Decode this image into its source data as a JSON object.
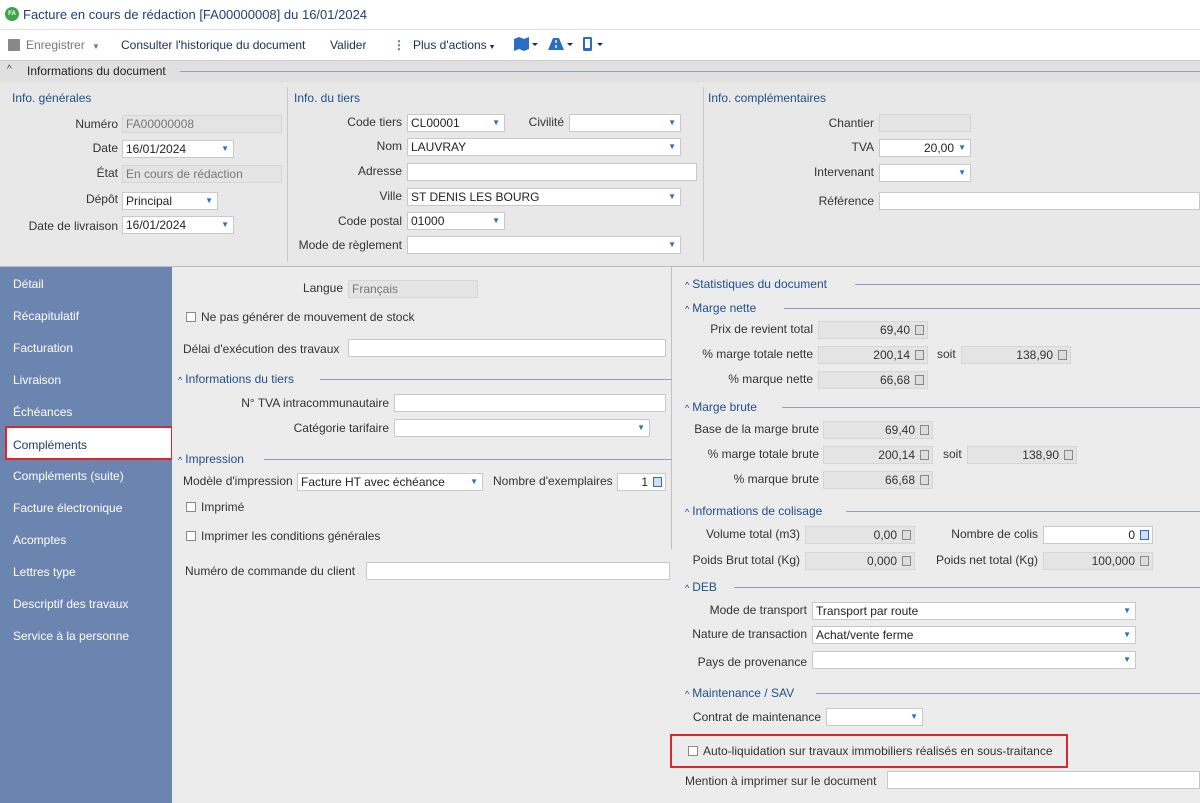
{
  "window": {
    "badge": "FA",
    "title": "Facture en cours de rédaction [FA00000008] du 16/01/2024"
  },
  "toolbar": {
    "save": "Enregistrer",
    "history": "Consulter l'historique du document",
    "validate": "Valider",
    "more": "Plus d'actions"
  },
  "info_header": "Informations du document",
  "general": {
    "title": "Info. générales",
    "numero_label": "Numéro",
    "numero": "FA00000008",
    "date_label": "Date",
    "date": "16/01/2024",
    "etat_label": "État",
    "etat": "En cours de rédaction",
    "depot_label": "Dépôt",
    "depot": "Principal",
    "livraison_label": "Date de livraison",
    "livraison": "16/01/2024"
  },
  "tiers": {
    "title": "Info. du tiers",
    "code_label": "Code tiers",
    "code": "CL00001",
    "civilite_label": "Civilité",
    "civilite": "",
    "nom_label": "Nom",
    "nom": "LAUVRAY",
    "adresse_label": "Adresse",
    "adresse": "",
    "ville_label": "Ville",
    "ville": "ST DENIS LES BOURG",
    "cp_label": "Code postal",
    "cp": "01000",
    "reglement_label": "Mode de règlement",
    "reglement": ""
  },
  "compl": {
    "title": "Info. complémentaires",
    "chantier_label": "Chantier",
    "chantier": "",
    "tva_label": "TVA",
    "tva": "20,00",
    "intervenant_label": "Intervenant",
    "intervenant": "",
    "reference_label": "Référence",
    "reference": ""
  },
  "sidebar": [
    "Détail",
    "Récapitulatif",
    "Facturation",
    "Livraison",
    "Échéances",
    "Compléments",
    "Compléments (suite)",
    "Facture électronique",
    "Acomptes",
    "Lettres type",
    "Descriptif des travaux",
    "Service à la personne"
  ],
  "left": {
    "langue_label": "Langue",
    "langue": "Français",
    "stock_label": "Ne pas générer de mouvement de stock",
    "delai_label": "Délai d'exécution des travaux",
    "delai": "",
    "tiers_group": "Informations du tiers",
    "tva_intra_label": "N° TVA intracommunautaire",
    "tva_intra": "",
    "categorie_label": "Catégorie tarifaire",
    "categorie": "",
    "impression_group": "Impression",
    "modele_label": "Modèle d'impression",
    "modele": "Facture HT avec échéance",
    "exemplaires_label": "Nombre d'exemplaires",
    "exemplaires": "1",
    "imprime_label": "Imprimé",
    "conditions_label": "Imprimer les conditions générales",
    "commande_label": "Numéro de commande du client",
    "commande": ""
  },
  "right": {
    "stats_group": "Statistiques du document",
    "marge_nette_group": "Marge nette",
    "prix_revient_label": "Prix de revient total",
    "prix_revient": "69,40",
    "pct_marge_nette_label": "% marge totale nette",
    "pct_marge_nette": "200,14",
    "soit_label": "soit",
    "soit_nette": "138,90",
    "pct_marque_nette_label": "% marque nette",
    "pct_marque_nette": "66,68",
    "marge_brute_group": "Marge brute",
    "base_marge_label": "Base de la marge brute",
    "base_marge": "69,40",
    "pct_marge_brute_label": "% marge totale brute",
    "pct_marge_brute": "200,14",
    "soit_brute": "138,90",
    "pct_marque_brute_label": "% marque brute",
    "pct_marque_brute": "66,68",
    "colisage_group": "Informations de colisage",
    "volume_label": "Volume total (m3)",
    "volume": "0,00",
    "colis_label": "Nombre de colis",
    "colis": "0",
    "poids_brut_label": "Poids Brut total (Kg)",
    "poids_brut": "0,000",
    "poids_net_label": "Poids net total (Kg)",
    "poids_net": "100,000",
    "deb_group": "DEB",
    "transport_label": "Mode de transport",
    "transport": "Transport par route",
    "transaction_label": "Nature de transaction",
    "transaction": "Achat/vente ferme",
    "provenance_label": "Pays de provenance",
    "provenance": "",
    "maintenance_group": "Maintenance / SAV",
    "contrat_label": "Contrat de maintenance",
    "contrat": "",
    "autoliq_label": "Auto-liquidation sur travaux immobiliers réalisés en sous-traitance",
    "mention_label": "Mention à imprimer sur le document",
    "mention": ""
  }
}
